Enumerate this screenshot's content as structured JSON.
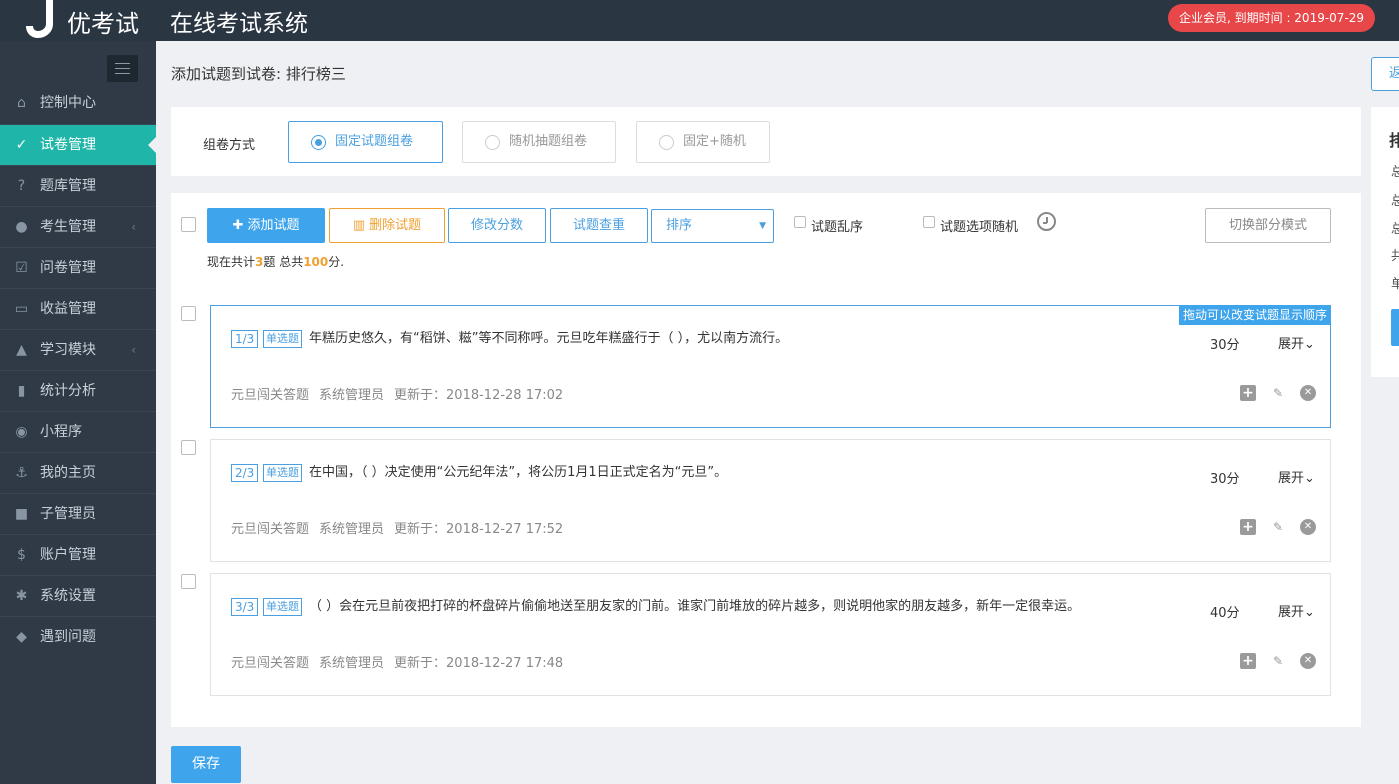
{
  "header": {
    "logo_text": "优考试",
    "app_title": "在线考试系统",
    "member_badge": "企业会员, 到期时间 : 2019-07-29"
  },
  "sidebar": {
    "items": [
      {
        "label": "控制中心",
        "icon": "home-icon"
      },
      {
        "label": "试卷管理",
        "icon": "check-circle-icon",
        "active": true
      },
      {
        "label": "题库管理",
        "icon": "question-circle-icon"
      },
      {
        "label": "考生管理",
        "icon": "user-icon",
        "has_submenu": true
      },
      {
        "label": "问卷管理",
        "icon": "checkbox-icon"
      },
      {
        "label": "收益管理",
        "icon": "credit-card-icon"
      },
      {
        "label": "学习模块",
        "icon": "graduation-cap-icon",
        "has_submenu": true
      },
      {
        "label": "统计分析",
        "icon": "bar-chart-icon"
      },
      {
        "label": "小程序",
        "icon": "wechat-icon"
      },
      {
        "label": "我的主页",
        "icon": "anchor-icon"
      },
      {
        "label": "子管理员",
        "icon": "lock-icon"
      },
      {
        "label": "账户管理",
        "icon": "dollar-icon"
      },
      {
        "label": "系统设置",
        "icon": "gear-icon"
      },
      {
        "label": "遇到问题",
        "icon": "tag-icon"
      }
    ]
  },
  "page": {
    "title": "添加试题到试卷: 排行榜三",
    "back_label": "返回"
  },
  "mode": {
    "label": "组卷方式",
    "options": [
      "固定试题组卷",
      "随机抽题组卷",
      "固定+随机"
    ],
    "selected": 0
  },
  "toolbar": {
    "add_label": "添加试题",
    "delete_label": "删除试题",
    "modify_score_label": "修改分数",
    "dedupe_label": "试题查重",
    "sort_label": "排序",
    "shuffle_label": "试题乱序",
    "option_random_label": "试题选项随机",
    "switch_label": "切换部分模式"
  },
  "summary": {
    "prefix": "现在共计",
    "count": "3",
    "mid": "题 总共",
    "score": "100",
    "suffix": "分."
  },
  "drag_hint": "拖动可以改变试题显示顺序",
  "questions": [
    {
      "index": "1/3",
      "type": "单选题",
      "text": "年糕历史悠久，有“稻饼、糍”等不同称呼。元旦吃年糕盛行于（     ），尤以南方流行。",
      "score": "30分",
      "expand": "展开",
      "bank": "元旦闯关答题",
      "author": "系统管理员",
      "updated": "更新于：2018-12-28 17:02"
    },
    {
      "index": "2/3",
      "type": "单选题",
      "text": "在中国，（     ）决定使用“公元纪年法”，将公历1月1日正式定名为“元旦”。",
      "score": "30分",
      "expand": "展开",
      "bank": "元旦闯关答题",
      "author": "系统管理员",
      "updated": "更新于：2018-12-27 17:52"
    },
    {
      "index": "3/3",
      "type": "单选题",
      "text": "（     ）会在元旦前夜把打碎的杯盘碎片偷偷地送至朋友家的门前。谁家门前堆放的碎片越多，则说明他家的朋友越多，新年一定很幸运。",
      "score": "40分",
      "expand": "展开",
      "bank": "元旦闯关答题",
      "author": "系统管理员",
      "updated": "更新于：2018-12-27 17:48"
    }
  ],
  "save_label": "保存"
}
